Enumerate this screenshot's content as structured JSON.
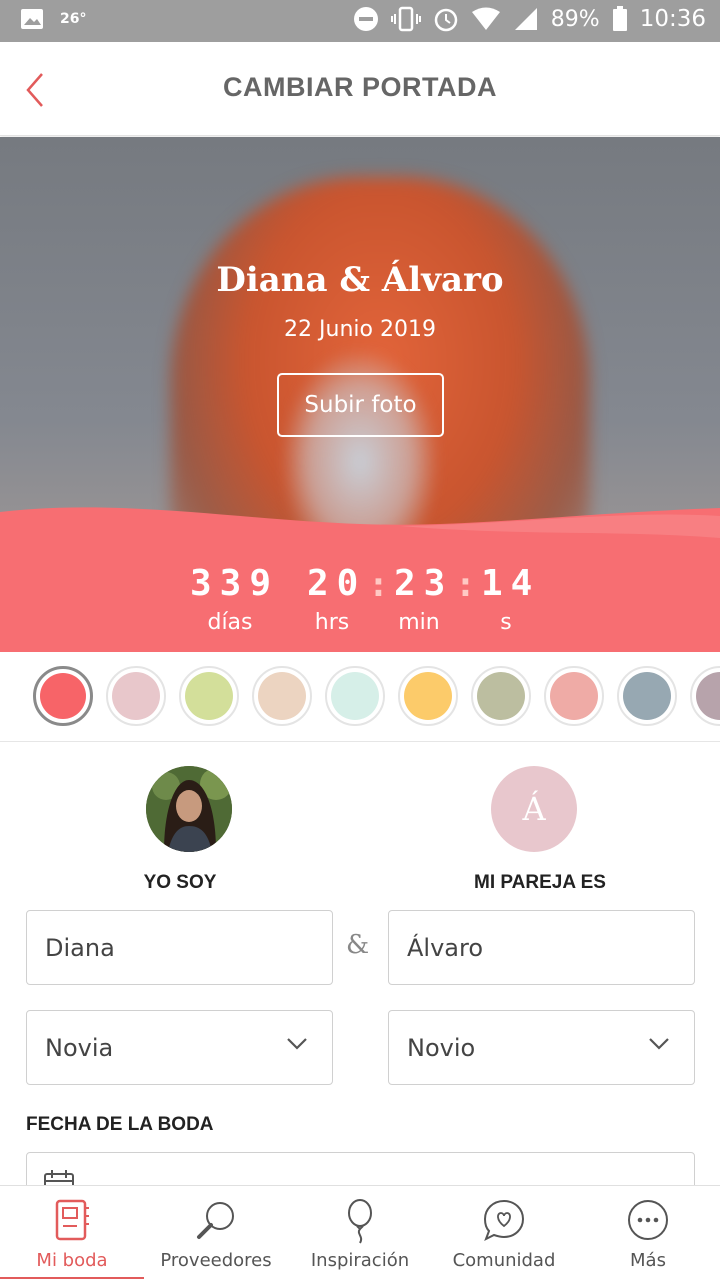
{
  "status_bar": {
    "temperature": "26°",
    "battery": "89%",
    "time": "10:36"
  },
  "header": {
    "title": "CAMBIAR PORTADA"
  },
  "cover": {
    "names": "Diana & Álvaro",
    "date": "22 Junio 2019",
    "upload_label": "Subir foto"
  },
  "countdown": {
    "days": "339",
    "hours": "20",
    "minutes": "23",
    "seconds": "14",
    "days_label": "días",
    "hours_label": "hrs",
    "minutes_label": "min",
    "seconds_label": "s",
    "accent_color": "#f76e72"
  },
  "palette": {
    "colors": [
      "#f76468",
      "#e8c7cb",
      "#d3df9a",
      "#ecd4c1",
      "#d6efe8",
      "#fccb6a",
      "#bcbea0",
      "#efaba6",
      "#97a8b2",
      "#b7a3ab"
    ],
    "selected_index": 0
  },
  "profile": {
    "me_label": "YO SOY",
    "partner_label": "MI PAREJA ES",
    "partner_initial": "Á",
    "me_name": "Diana",
    "partner_name": "Álvaro",
    "ampersand": "&",
    "me_role": "Novia",
    "partner_role": "Novio"
  },
  "wedding_date": {
    "section_title": "FECHA DE LA BODA"
  },
  "bottom_nav": {
    "items": [
      {
        "label": "Mi boda",
        "icon": "planner-book-icon",
        "active": true
      },
      {
        "label": "Proveedores",
        "icon": "search-magnifier-icon",
        "active": false
      },
      {
        "label": "Inspiración",
        "icon": "balloon-icon",
        "active": false
      },
      {
        "label": "Comunidad",
        "icon": "chat-heart-icon",
        "active": false
      },
      {
        "label": "Más",
        "icon": "more-dots-icon",
        "active": false
      }
    ],
    "active_color": "#e25b5b"
  }
}
